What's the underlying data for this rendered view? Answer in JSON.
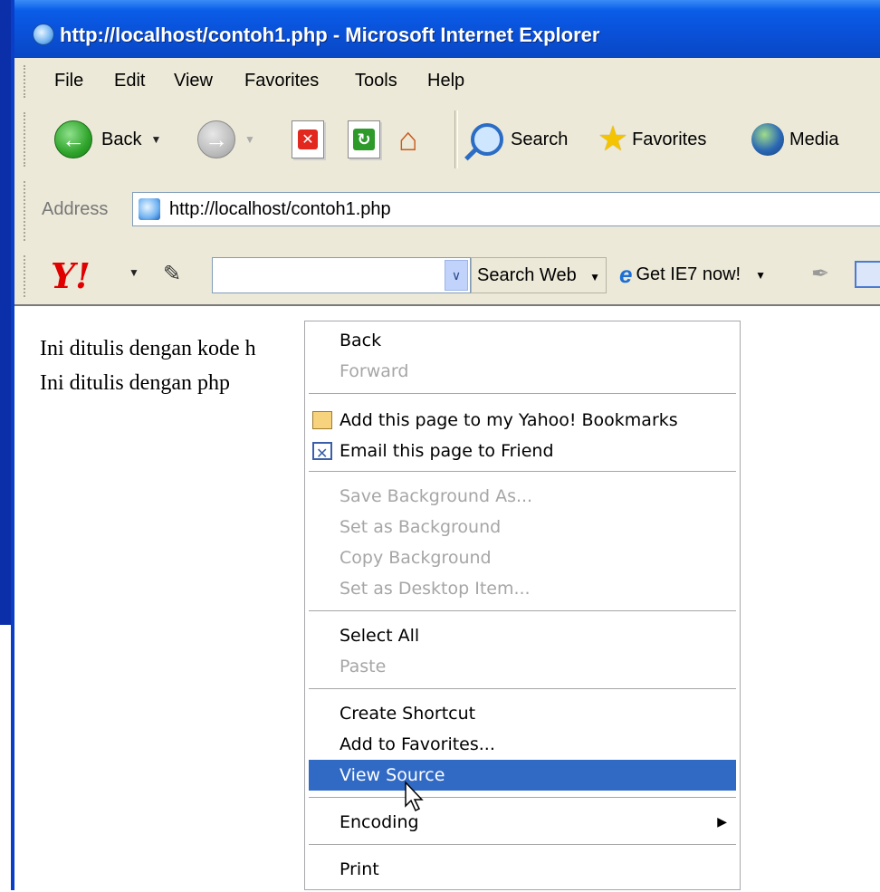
{
  "window": {
    "title": "http://localhost/contoh1.php - Microsoft Internet Explorer"
  },
  "menubar": {
    "items": [
      "File",
      "Edit",
      "View",
      "Favorites",
      "Tools",
      "Help"
    ]
  },
  "toolbar": {
    "back_label": "Back",
    "search_label": "Search",
    "favorites_label": "Favorites",
    "media_label": "Media"
  },
  "address": {
    "label": "Address",
    "url": "http://localhost/contoh1.php"
  },
  "yahoo_toolbar": {
    "logo": "Y!",
    "search_value": "",
    "search_button": "Search Web",
    "ie7_label": "Get IE7 now!"
  },
  "page_content": {
    "lines": [
      "Ini ditulis dengan kode h",
      "Ini ditulis dengan php"
    ]
  },
  "context_menu": {
    "back": "Back",
    "forward": "Forward",
    "add_yahoo": "Add this page to my Yahoo! Bookmarks",
    "email": "Email this page to Friend",
    "save_bg": "Save Background As...",
    "set_bg": "Set as Background",
    "copy_bg": "Copy Background",
    "set_desktop": "Set as Desktop Item...",
    "select_all": "Select All",
    "paste": "Paste",
    "create_shortcut": "Create Shortcut",
    "add_favorites": "Add to Favorites...",
    "view_source": "View Source",
    "encoding": "Encoding",
    "print": "Print"
  },
  "colors": {
    "titlebar": "#0a51d9",
    "highlight": "#316ac5",
    "disabled_text": "#a6a6a6"
  }
}
